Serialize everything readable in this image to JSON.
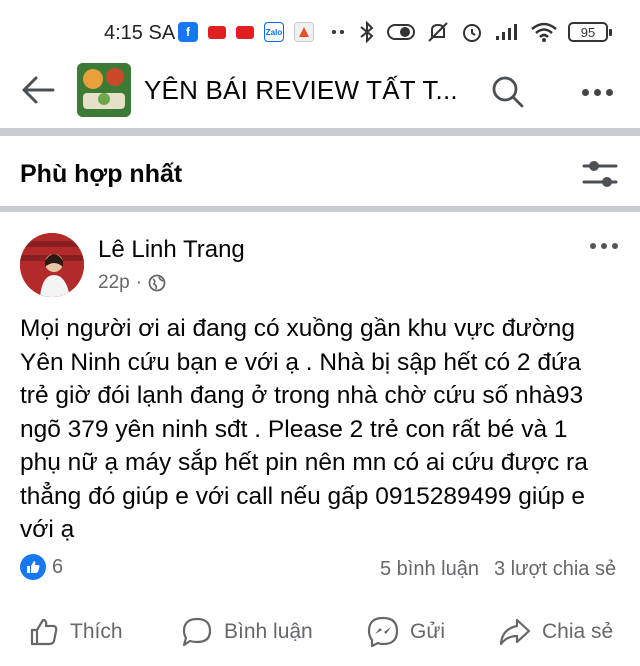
{
  "status_bar": {
    "time": "4:15 SA",
    "battery": "95"
  },
  "header": {
    "group_title": "YÊN BÁI REVIEW TẤT T..."
  },
  "sort": {
    "label": "Phù hợp nhất"
  },
  "post": {
    "author": "Lê Linh Trang",
    "time": "22p",
    "body_lines": [
      "Mọi người ơi ai đang có xuồng gần khu vực đường",
      "Yên Ninh cứu bạn e với ạ . Nhà bị sập hết có 2 đứa",
      "trẻ giờ đói lạnh đang ở trong nhà chờ cứu số nhà93",
      "ngõ 379 yên ninh sđt  . Please 2 trẻ con rất bé và 1",
      "phụ nữ ạ máy sắp hết pin nên mn có ai cứu được ra",
      "thẳng đó giúp e với call nếu gấp 0915289499 giúp e",
      "với ạ"
    ],
    "like_count": "6",
    "comment_count": "5 bình luận",
    "share_count": "3 lượt chia sẻ"
  },
  "actions": {
    "like": "Thích",
    "comment": "Bình luận",
    "send": "Gửi",
    "share": "Chia sẻ"
  },
  "colors": {
    "accent": "#1877f2",
    "muted_text": "#65676b",
    "separator": "#c9ccd1"
  }
}
